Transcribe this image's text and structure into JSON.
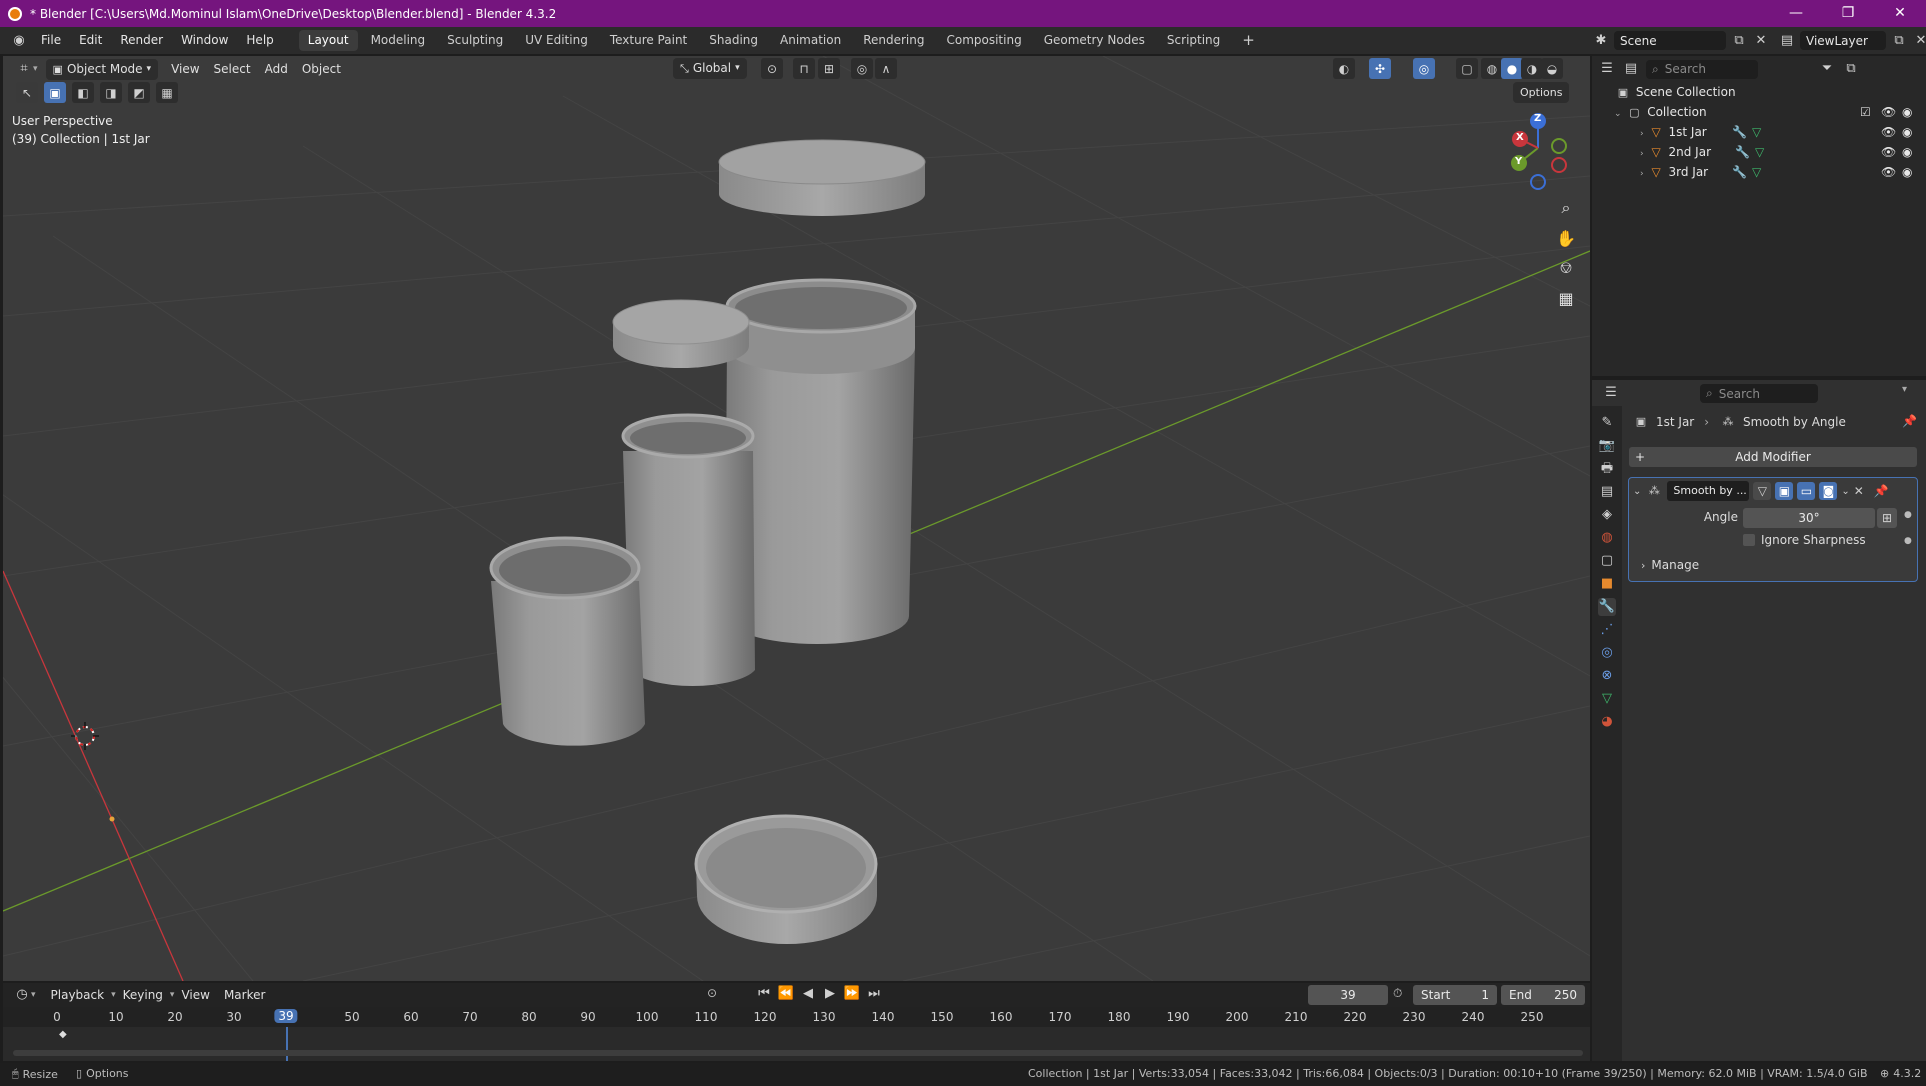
{
  "window": {
    "title": "* Blender [C:\\Users\\Md.Mominul Islam\\OneDrive\\Desktop\\Blender.blend] - Blender 4.3.2",
    "controls": [
      "—",
      "❐",
      "✕"
    ]
  },
  "menu": [
    "File",
    "Edit",
    "Render",
    "Window",
    "Help"
  ],
  "workspaces": [
    {
      "label": "Layout",
      "active": true
    },
    {
      "label": "Modeling"
    },
    {
      "label": "Sculpting"
    },
    {
      "label": "UV Editing"
    },
    {
      "label": "Texture Paint"
    },
    {
      "label": "Shading"
    },
    {
      "label": "Animation"
    },
    {
      "label": "Rendering"
    },
    {
      "label": "Compositing"
    },
    {
      "label": "Geometry Nodes"
    },
    {
      "label": "Scripting"
    }
  ],
  "add_workspace": "+",
  "scene": {
    "name": "Scene"
  },
  "view_layer": {
    "name": "ViewLayer"
  },
  "viewport_header": {
    "mode": "Object Mode",
    "menus": [
      "View",
      "Select",
      "Add",
      "Object"
    ],
    "transform_orientation": "Global",
    "options": "Options"
  },
  "viewport_info": {
    "perspective": "User Perspective",
    "collection": "(39) Collection | 1st Jar"
  },
  "gizmo": {
    "x": "X",
    "y": "Y",
    "z": "Z"
  },
  "outliner": {
    "search_placeholder": "Search",
    "scene_collection": "Scene Collection",
    "collection": "Collection",
    "objects": [
      {
        "name": "1st Jar"
      },
      {
        "name": "2nd Jar"
      },
      {
        "name": "3rd Jar"
      }
    ]
  },
  "properties": {
    "search_placeholder": "Search",
    "breadcrumb_object": "1st Jar",
    "breadcrumb_modifier": "Smooth by Angle",
    "add_modifier": "Add Modifier",
    "modifier_name": "Smooth by ...",
    "angle_label": "Angle",
    "angle_value": "30°",
    "ignore_sharpness": "Ignore Sharpness",
    "manage": "Manage"
  },
  "timeline": {
    "menus": [
      "Playback",
      "Keying",
      "View",
      "Marker"
    ],
    "current_frame": "39",
    "start_label": "Start",
    "start_value": "1",
    "end_label": "End",
    "end_value": "250",
    "ticks": [
      "0",
      "10",
      "20",
      "30",
      "39",
      "50",
      "60",
      "70",
      "80",
      "90",
      "100",
      "110",
      "120",
      "130",
      "140",
      "150",
      "160",
      "170",
      "180",
      "190",
      "200",
      "210",
      "220",
      "230",
      "240",
      "250"
    ]
  },
  "statusbar": {
    "resize": "Resize",
    "options": "Options",
    "stats": "Collection | 1st Jar | Verts:33,054 | Faces:33,042 | Tris:66,084 | Objects:0/3 | Duration: 00:10+10 (Frame 39/250) | Memory: 62.0 MiB | VRAM: 1.5/4.0 GiB",
    "version": "4.3.2"
  },
  "colors": {
    "title_bar": "#75157e",
    "accent": "#4772b3",
    "object_orange": "#e68a2e",
    "x_axis": "#c8363c",
    "y_axis": "#6b9a2b"
  }
}
